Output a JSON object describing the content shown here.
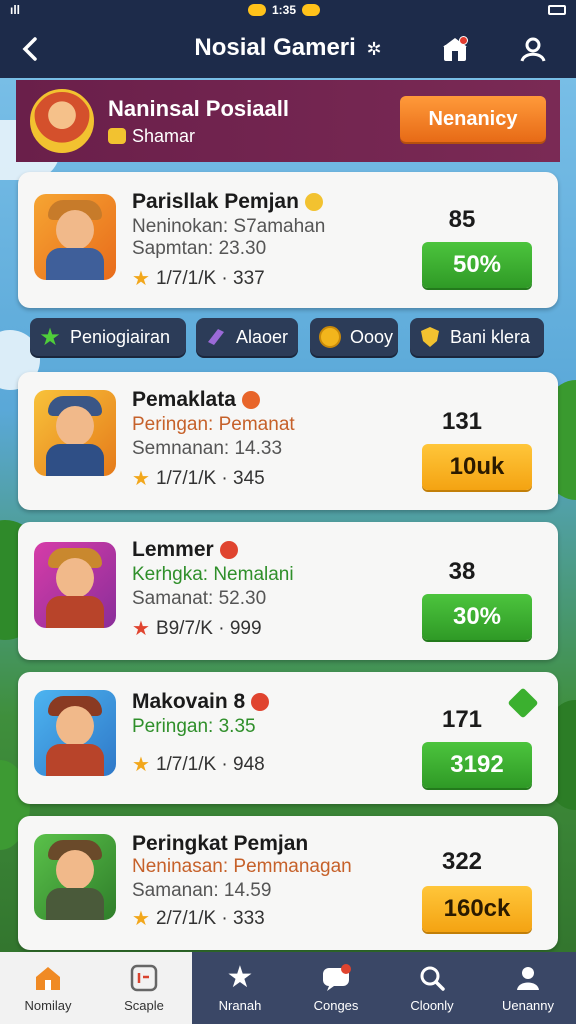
{
  "status_bar": {
    "left": "ıll",
    "time": "1:35"
  },
  "header": {
    "title": "Nosial Gameri",
    "gear": "✲"
  },
  "profile": {
    "name": "Naninsal Posiaall",
    "subtitle": "Shamar",
    "action_label": "Nenanicy"
  },
  "cards": [
    {
      "name": "Parisllak Pemjan",
      "line1": "Neninokan: S7amahan",
      "line2": "Sapmtan: 23.30",
      "rating": "1/7/1/K · 337",
      "score": "85",
      "button": "50%",
      "button_color": "green",
      "badge_color": "#f2c230"
    },
    {
      "name": "Pemaklata",
      "line1": "Peringan: Pemanat",
      "line2": "Semnanan: 14.33",
      "rating": "1/7/1/K · 345",
      "score": "131",
      "button": "10uk",
      "button_color": "orange",
      "badge_color": "#e8652a"
    },
    {
      "name": "Lemmer",
      "line1": "Kerhgka: Nemalani",
      "line2": "Samanat: 52.30",
      "rating": "B9/7/K · 999",
      "score": "38",
      "button": "30%",
      "button_color": "green",
      "badge_color": "#e0442f"
    },
    {
      "name": "Makovain 8",
      "line1": "Peringan: 3.35",
      "line2": "",
      "rating": "1/7/1/K · 948",
      "score": "171",
      "button": "3192",
      "button_color": "green",
      "badge_color": "#e0442f"
    },
    {
      "name": "Peringkat Pemjan",
      "line1": "Neninasan: Pemmanagan",
      "line2": "Samanan: 14.59",
      "rating": "2/7/1/K · 333",
      "score": "322",
      "button": "160ck",
      "button_color": "orange",
      "badge_color": ""
    }
  ],
  "chips": [
    {
      "label": "Peniogiairan",
      "icon": "star-icon"
    },
    {
      "label": "Alaoer",
      "icon": "crystal-icon"
    },
    {
      "label": "Oooy",
      "icon": "coin-icon"
    },
    {
      "label": "Bani klera",
      "icon": "shield-icon"
    }
  ],
  "nav": [
    {
      "label": "Nomilay",
      "icon": "home-icon"
    },
    {
      "label": "Scaple",
      "icon": "leaderboard-icon"
    },
    {
      "label": "Nranah",
      "icon": "star-icon"
    },
    {
      "label": "Conges",
      "icon": "chat-icon"
    },
    {
      "label": "Cloonly",
      "icon": "search-icon"
    },
    {
      "label": "Uenanny",
      "icon": "user-icon"
    }
  ],
  "colors": {
    "header": "#1d2b4a",
    "profile": "#6a1f4a",
    "green": "#3bb02f",
    "orange": "#f4a312"
  }
}
